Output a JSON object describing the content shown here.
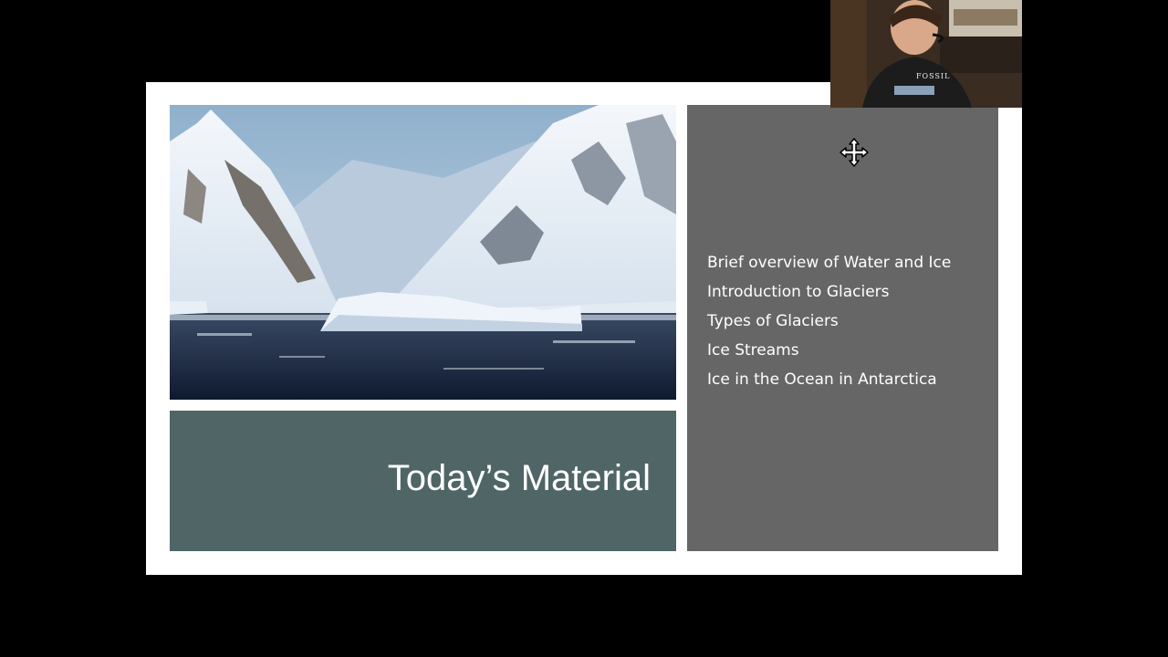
{
  "slide": {
    "title": "Today’s Material",
    "agenda_items": [
      "Brief overview of Water and Ice",
      "Introduction to Glaciers",
      "Types of Glaciers",
      "Ice Streams",
      "Ice in the Ocean in Antarctica"
    ],
    "colors": {
      "title_box": "#4f6566",
      "agenda_box": "#666666",
      "slide_background": "#ffffff",
      "screen_background": "#000000"
    }
  },
  "webcam": {
    "shirt_text": "FOSSIL"
  },
  "cursor": {
    "icon": "move-cursor-icon"
  }
}
